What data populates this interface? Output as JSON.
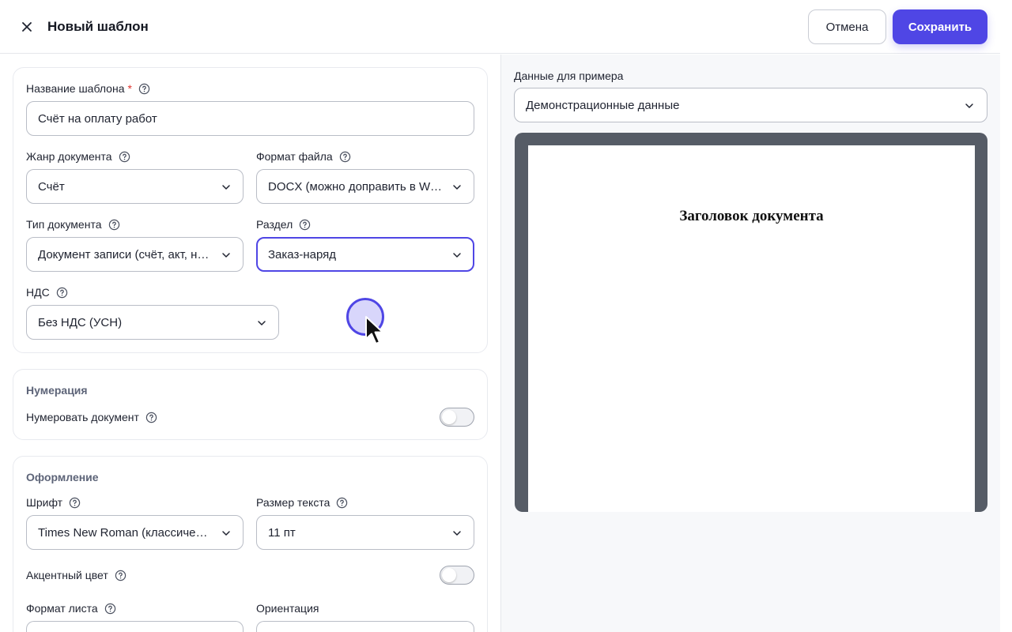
{
  "header": {
    "title": "Новый шаблон",
    "cancel_label": "Отмена",
    "save_label": "Сохранить"
  },
  "main_card": {
    "template_name": {
      "label": "Название шаблона",
      "required_mark": "*",
      "value": "Счёт на оплату работ"
    },
    "genre": {
      "label": "Жанр документа",
      "value": "Счёт"
    },
    "file_format": {
      "label": "Формат файла",
      "value": "DOCX (можно доправить в Word)"
    },
    "doc_type": {
      "label": "Тип документа",
      "value": "Документ записи (счёт, акт, накладная)"
    },
    "section": {
      "label": "Раздел",
      "value": "Заказ-наряд"
    },
    "vat": {
      "label": "НДС",
      "value": "Без НДС (УСН)"
    }
  },
  "numbering_card": {
    "title": "Нумерация",
    "toggle_label": "Нумеровать документ",
    "toggle_on": false
  },
  "design_card": {
    "title": "Оформление",
    "font": {
      "label": "Шрифт",
      "value": "Times New Roman (классический)"
    },
    "font_size": {
      "label": "Размер текста",
      "value": "11 пт"
    },
    "accent_color": {
      "label": "Акцентный цвет",
      "toggle_on": false
    },
    "sheet_format": {
      "label": "Формат листа"
    },
    "orientation": {
      "label": "Ориентация"
    }
  },
  "preview": {
    "data_label": "Данные для примера",
    "data_value": "Демонстрационные данные",
    "doc_heading": "Заголовок документа"
  },
  "colors": {
    "accent": "#4f46e5",
    "required": "#e0322c",
    "section_title": "#5d6478",
    "preview_frame": "#565c66"
  },
  "icons": {
    "close": "close-icon",
    "help": "help-circle-icon",
    "chevron": "chevron-down-icon"
  }
}
